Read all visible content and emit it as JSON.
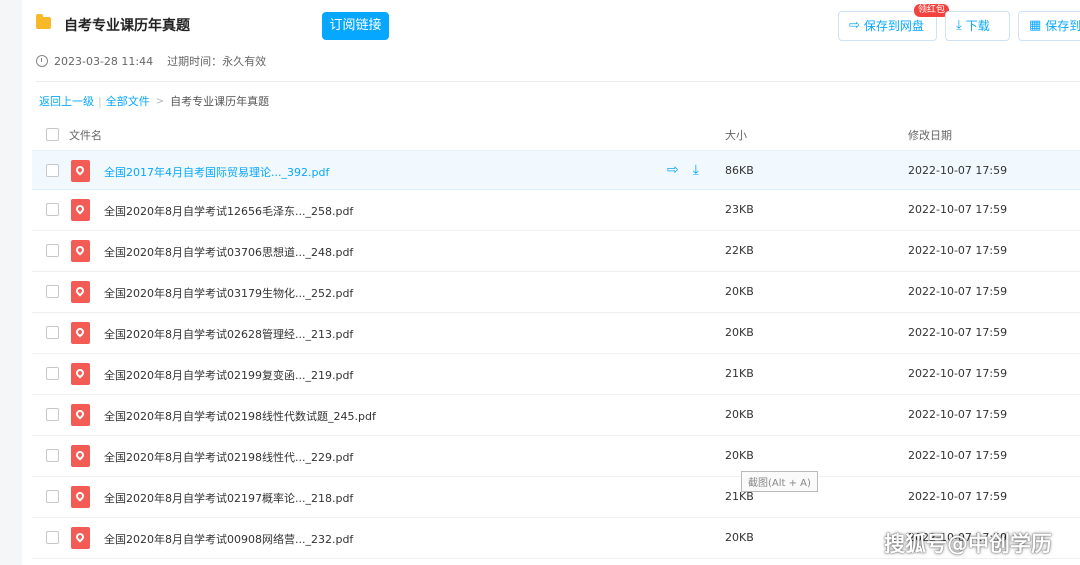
{
  "header": {
    "title": "自考专业课历年真题",
    "subscribe_label": "订阅链接",
    "created": "2023-03-28 11:44",
    "expiry": "过期时间：永久有效",
    "save_label": "保存到网盘",
    "save_badge": "领红包",
    "download_label": "下载",
    "save_label_2": "保存到"
  },
  "breadcrumb": {
    "back": "返回上一级",
    "sep": "|",
    "all_files": "全部文件",
    "arrow": ">",
    "current": "自考专业课历年真题"
  },
  "table": {
    "col_name": "文件名",
    "col_size": "大小",
    "col_date": "修改日期",
    "rows": [
      {
        "name": "全国2017年4月自考国际贸易理论..._392.pdf",
        "size": "86KB",
        "date": "2022-10-07 17:59"
      },
      {
        "name": "全国2020年8月自学考试12656毛泽东..._258.pdf",
        "size": "23KB",
        "date": "2022-10-07 17:59"
      },
      {
        "name": "全国2020年8月自学考试03706思想道..._248.pdf",
        "size": "22KB",
        "date": "2022-10-07 17:59"
      },
      {
        "name": "全国2020年8月自学考试03179生物化..._252.pdf",
        "size": "20KB",
        "date": "2022-10-07 17:59"
      },
      {
        "name": "全国2020年8月自学考试02628管理经..._213.pdf",
        "size": "20KB",
        "date": "2022-10-07 17:59"
      },
      {
        "name": "全国2020年8月自学考试02199复变函..._219.pdf",
        "size": "21KB",
        "date": "2022-10-07 17:59"
      },
      {
        "name": "全国2020年8月自学考试02198线性代数试题_245.pdf",
        "size": "20KB",
        "date": "2022-10-07 17:59"
      },
      {
        "name": "全国2020年8月自学考试02198线性代..._229.pdf",
        "size": "20KB",
        "date": "2022-10-07 17:59"
      },
      {
        "name": "全国2020年8月自学考试02197概率论..._218.pdf",
        "size": "21KB",
        "date": "2022-10-07 17:59"
      },
      {
        "name": "全国2020年8月自学考试00908网络营..._232.pdf",
        "size": "20KB",
        "date": "2022-10-07 17:59"
      }
    ]
  },
  "tooltip": "截图(Alt + A)",
  "watermark": "搜狐号@中创学历",
  "colors": {
    "accent": "#06a7ff",
    "pdf": "#f25c54",
    "folder": "#f7b928"
  }
}
